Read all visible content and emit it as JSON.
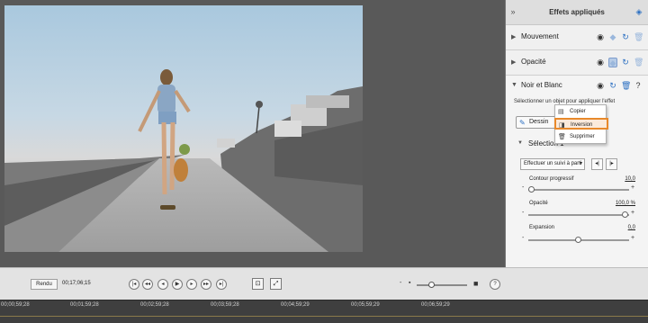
{
  "panel": {
    "title": "Effets appliqués",
    "effects": [
      {
        "name": "Mouvement"
      },
      {
        "name": "Opacité"
      },
      {
        "name": "Noir et Blanc"
      }
    ],
    "hint": "Sélectionner un objet pour appliquer l'effet",
    "draw_button": "Dessin",
    "selection_label": "Sélection 1",
    "tracking_dropdown": "Effectuer un suivi à parti",
    "params": [
      {
        "label": "Contour progressif",
        "value": "10,0"
      },
      {
        "label": "Opacité",
        "value": "100,0 %"
      },
      {
        "label": "Expansion",
        "value": "0,0"
      }
    ]
  },
  "context_menu": {
    "items": [
      "Copier",
      "Inversion",
      "Supprimer"
    ],
    "highlighted": "Inversion",
    "highlight_color": "#e8892b"
  },
  "transport": {
    "render_button": "Rendu",
    "timecode": "00;17;06;15"
  },
  "ruler": {
    "labels": [
      "00;00;59;28",
      "00;01;59;28",
      "00;02;59;28",
      "00;03;59;28",
      "00;04;59;29",
      "00;05;59;29",
      "00;06;59;29"
    ]
  }
}
